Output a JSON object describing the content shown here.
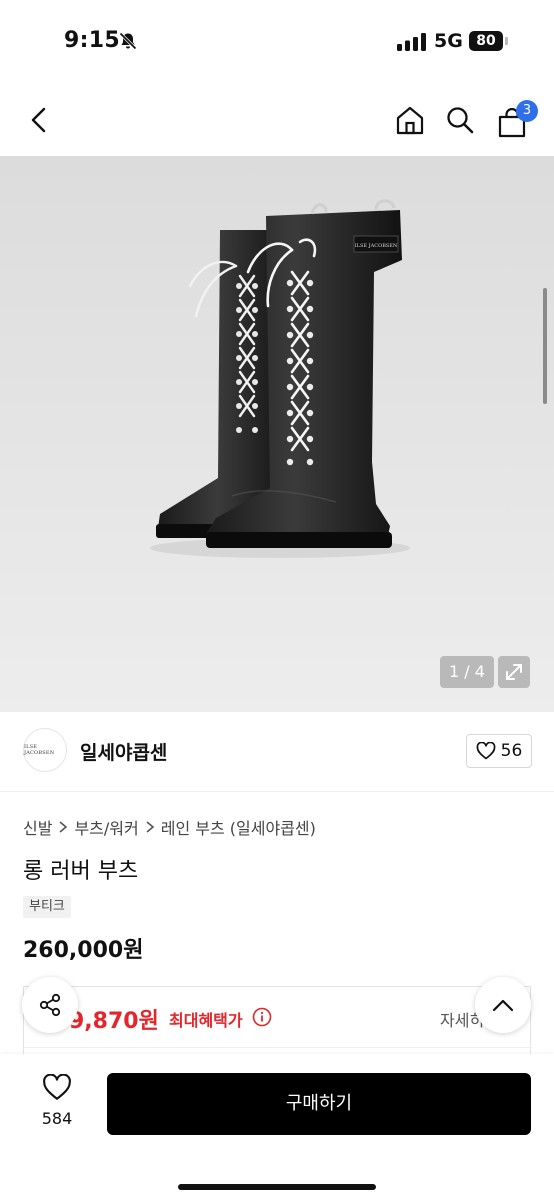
{
  "status": {
    "time": "9:15",
    "network": "5G",
    "battery": "80"
  },
  "header": {
    "cart_count": "3"
  },
  "gallery": {
    "page_indicator": "1 / 4",
    "boot_brand_text": "ILSE JACOBSEN"
  },
  "brand": {
    "logo_text": "ILSE JACOBSEN",
    "name": "일세야콥센",
    "likes": "56"
  },
  "breadcrumb": {
    "items": [
      "신발",
      "부츠/워커",
      "레인 부츠 (일세야콥센)"
    ]
  },
  "product": {
    "title": "롱 러버 부츠",
    "tag": "부티크",
    "price": "260,000원"
  },
  "benefit": {
    "price": "9,870원",
    "label": "최대혜택가",
    "detail": "자세히"
  },
  "bottom_bar": {
    "wish_count": "584",
    "buy_label": "구매하기"
  },
  "colors": {
    "accent_red": "#e3262b",
    "badge_blue": "#2f6fe8",
    "buy_button": "#000000"
  },
  "icons": [
    "bell-slash-icon",
    "signal-icon",
    "battery-icon",
    "back-icon",
    "home-icon",
    "search-icon",
    "cart-icon",
    "expand-icon",
    "heart-icon",
    "info-icon",
    "share-icon",
    "chevron-up-icon"
  ]
}
